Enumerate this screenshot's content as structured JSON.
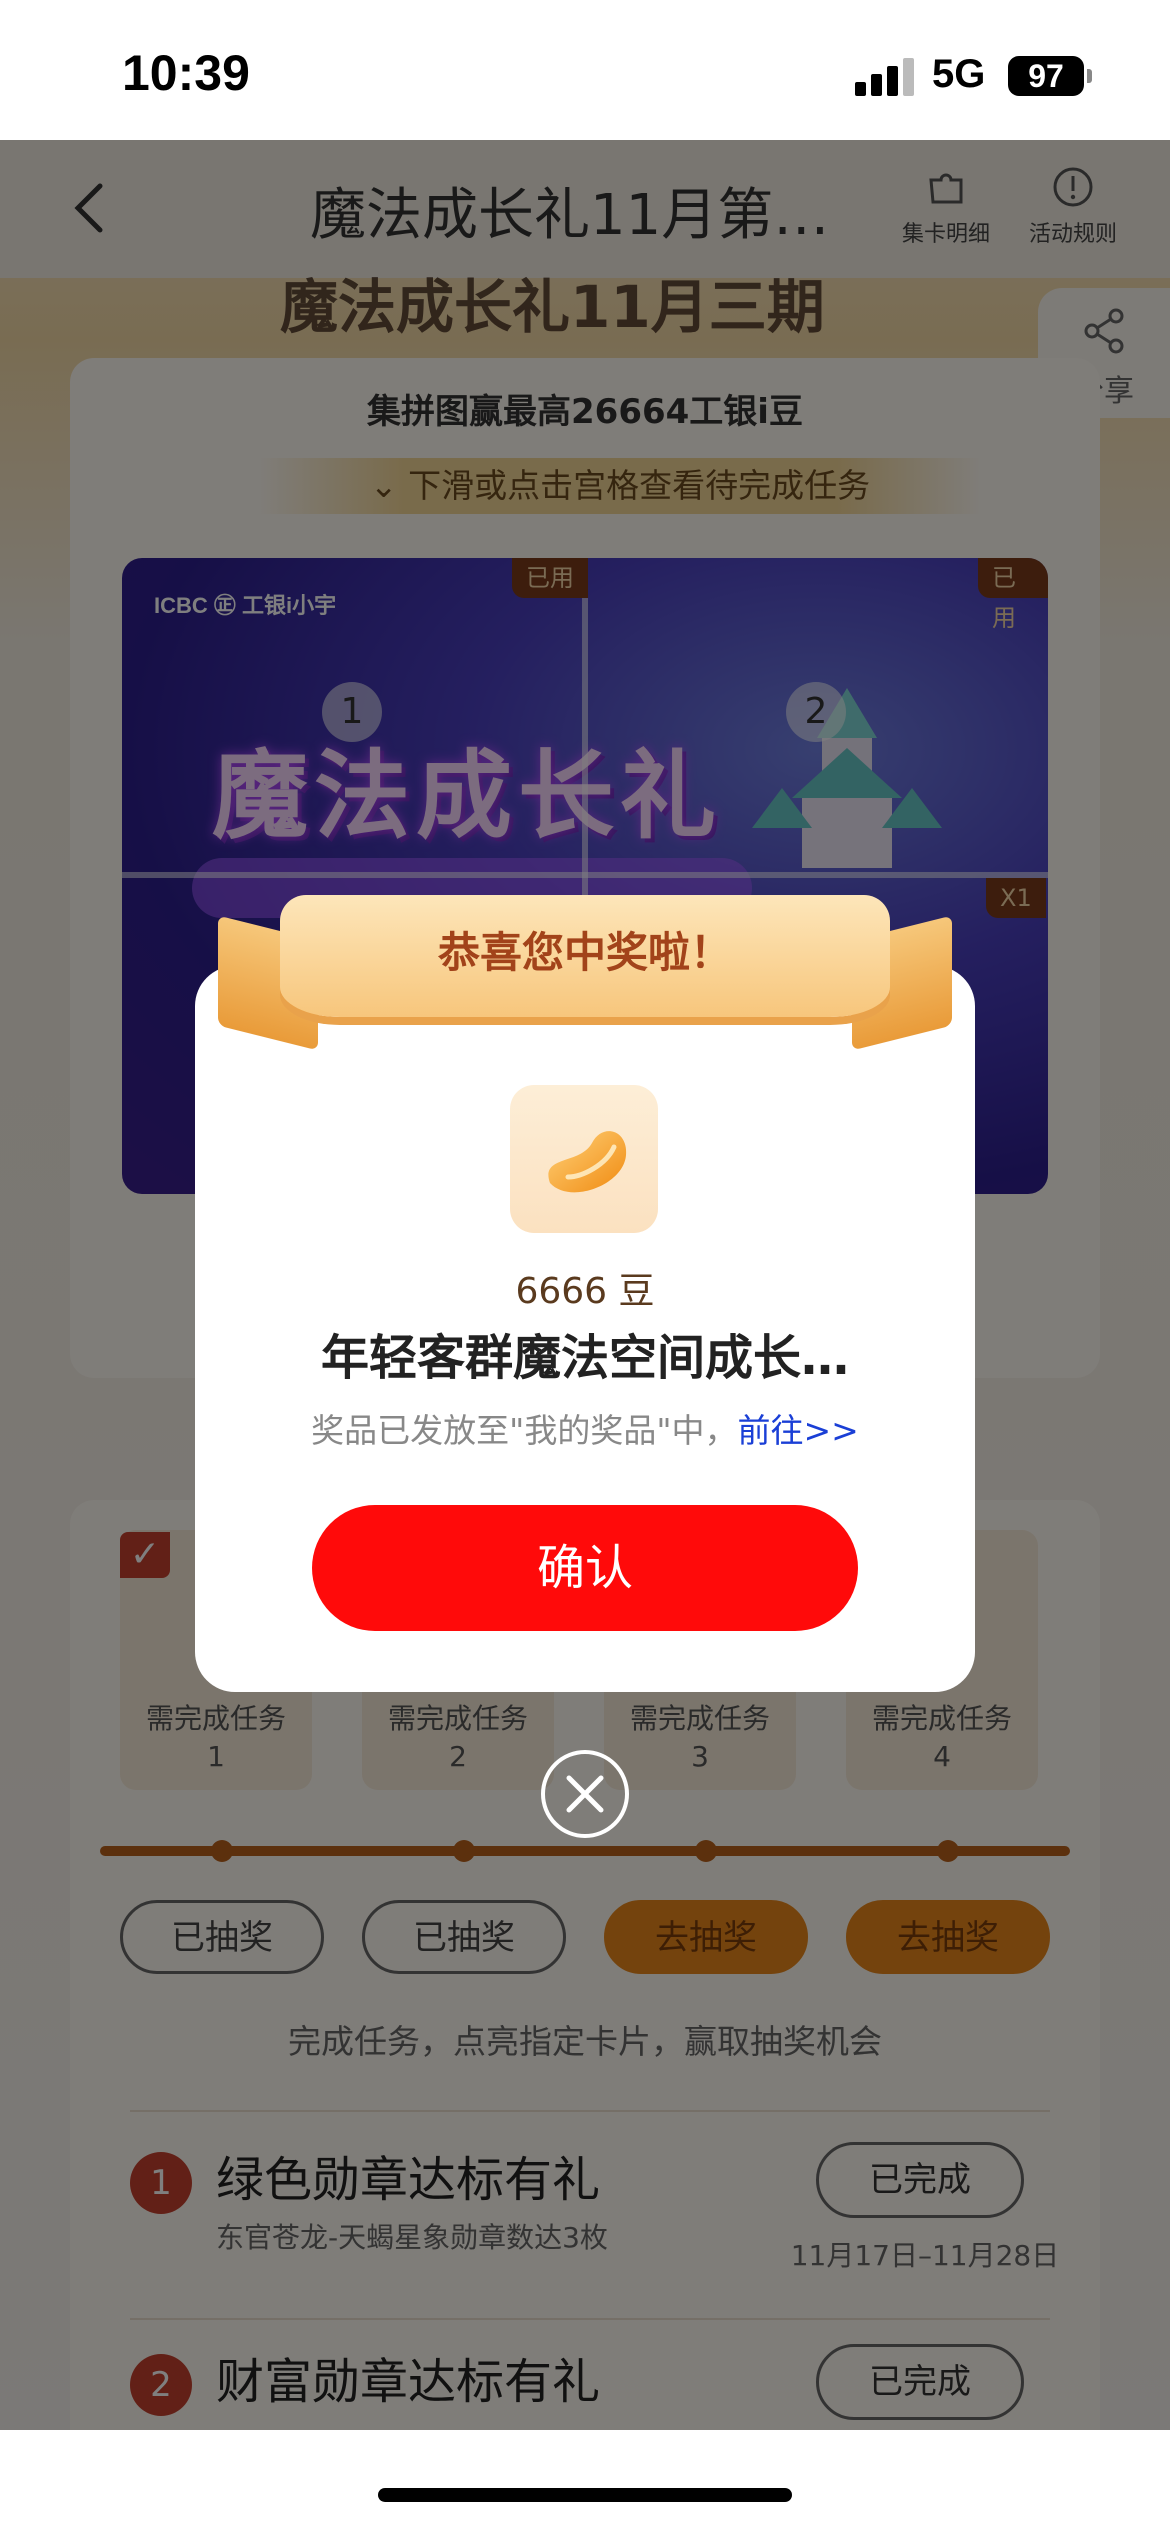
{
  "status_bar": {
    "time": "10:39",
    "network": "5G",
    "battery": "97"
  },
  "nav": {
    "title": "魔法成长礼11月第…",
    "actions": [
      {
        "label": "集卡明细",
        "icon": "puzzle-piece-icon"
      },
      {
        "label": "活动规则",
        "icon": "info-circle-icon"
      }
    ]
  },
  "headline": "魔法成长礼11月三期",
  "share_label": "分享",
  "card": {
    "title": "集拼图赢最高26664工银i豆",
    "hint": "下滑或点击宫格查看待完成任务",
    "puzzle": {
      "logo": "ICBC ㊣ 工银i小宇",
      "artwork_title": "魔法成长礼",
      "tags": [
        "已用",
        "已用",
        "X1"
      ],
      "numbers": [
        "1",
        "2"
      ]
    }
  },
  "stages": [
    {
      "label": "需完成任务",
      "num": "1",
      "status": "已抽奖"
    },
    {
      "label": "需完成任务",
      "num": "2",
      "status": "已抽奖"
    },
    {
      "label": "需完成任务",
      "num": "3",
      "status": "去抽奖"
    },
    {
      "label": "需完成任务",
      "num": "4",
      "status": "去抽奖"
    }
  ],
  "tip": "完成任务，点亮指定卡片，赢取抽奖机会",
  "tasks": [
    {
      "num": "1",
      "title": "绿色勋章达标有礼",
      "desc": "东官苍龙-天蝎星象勋章数达3枚",
      "button": "已完成",
      "date": "11月17日–11月28日"
    },
    {
      "num": "2",
      "title": "财富勋章达标有礼",
      "desc": "",
      "button": "已完成",
      "date": ""
    }
  ],
  "modal": {
    "ribbon": "恭喜您中奖啦！",
    "prize_icon": "golden-bean-icon",
    "amount": "6666 豆",
    "name": "年轻客群魔法空间成长…",
    "note": "奖品已发放至\"我的奖品\"中，",
    "link": "前往>>",
    "confirm": "确认"
  },
  "colors": {
    "accent": "#ff0a0a",
    "brand_orange": "#e8871b",
    "ribbon_text": "#a2431a",
    "link": "#1a3fd6"
  }
}
